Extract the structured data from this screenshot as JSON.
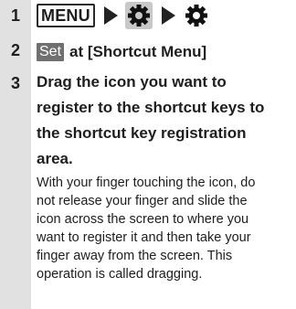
{
  "steps": [
    {
      "number": "1",
      "menu_key": "MENU",
      "icons": [
        "settings-gear-icon",
        "settings-gear-icon"
      ]
    },
    {
      "number": "2",
      "label": "Set",
      "text": "at [Shortcut Menu]"
    },
    {
      "number": "3",
      "heading_lines": [
        "Drag the icon you want to",
        "register to the shortcut keys to",
        "the shortcut key registration",
        "area."
      ],
      "body_lines": [
        "With your finger touching the icon, do",
        "not release your finger and slide the",
        "icon across the screen to where you",
        "want to register it and then take your",
        "finger away from the screen. This",
        "operation is called dragging."
      ]
    }
  ]
}
